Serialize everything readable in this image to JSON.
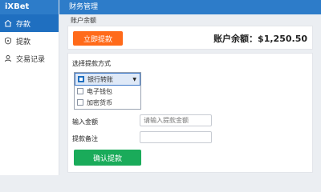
{
  "app": {
    "logo": "iXBet",
    "page_title": "财务管理"
  },
  "sidebar": {
    "items": [
      {
        "label": "存款",
        "icon": "home-icon",
        "active": true
      },
      {
        "label": "提款",
        "icon": "shield-icon",
        "active": false
      },
      {
        "label": "交易记录",
        "icon": "user-icon",
        "active": false
      }
    ]
  },
  "balance": {
    "section_title": "账户余额",
    "withdraw_button": "立即提款",
    "text": "账户余额：$1,250.50"
  },
  "form": {
    "method_label": "选择提款方式",
    "methods": [
      "银行转账",
      "电子钱包",
      "加密货币"
    ],
    "amount_label": "输入金额",
    "amount_placeholder": "请输入提款金额",
    "note_label": "提款备注",
    "note_placeholder": "",
    "confirm_button": "确认提款"
  },
  "colors": {
    "primary": "#2d7cc9",
    "withdraw": "#ff6a1a",
    "confirm": "#1aab5a"
  }
}
